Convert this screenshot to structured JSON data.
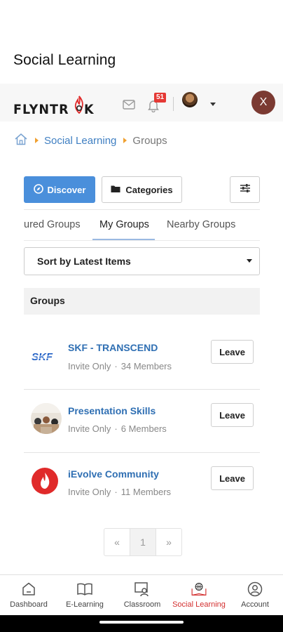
{
  "app": {
    "title": "Social Learning"
  },
  "header": {
    "logo_text_left": "FLYNTR",
    "logo_text_right": "K",
    "notification_count": "51",
    "user_initial": "X"
  },
  "breadcrumb": {
    "items": [
      "Social Learning",
      "Groups"
    ]
  },
  "actions": {
    "discover_label": "Discover",
    "categories_label": "Categories"
  },
  "tabs": [
    {
      "label": "ured Groups"
    },
    {
      "label": "My Groups",
      "active": true
    },
    {
      "label": "Nearby Groups"
    }
  ],
  "sort": {
    "selected": "Sort by Latest Items"
  },
  "groups": {
    "header": "Groups",
    "items": [
      {
        "name": "SKF - TRANSCEND",
        "privacy": "Invite Only",
        "members": "34 Members",
        "logo_text": "SKF",
        "action": "Leave"
      },
      {
        "name": "Presentation Skills",
        "privacy": "Invite Only",
        "members": "6 Members",
        "action": "Leave"
      },
      {
        "name": "iEvolve Community",
        "privacy": "Invite Only",
        "members": "11 Members",
        "action": "Leave"
      }
    ],
    "separator": "·"
  },
  "pagination": {
    "prev": "«",
    "current": "1",
    "next": "»"
  },
  "bottom_nav": [
    {
      "label": "Dashboard",
      "icon": "home-icon"
    },
    {
      "label": "E-Learning",
      "icon": "book-icon"
    },
    {
      "label": "Classroom",
      "icon": "classroom-icon"
    },
    {
      "label": "Social Learning",
      "icon": "globe-book-icon",
      "active": true
    },
    {
      "label": "Account",
      "icon": "user-circle-icon"
    }
  ],
  "colors": {
    "accent": "#4a8fdb",
    "link": "#2f6fb3",
    "active_nav": "#d32f2f",
    "brand_red": "#e02a2a"
  }
}
